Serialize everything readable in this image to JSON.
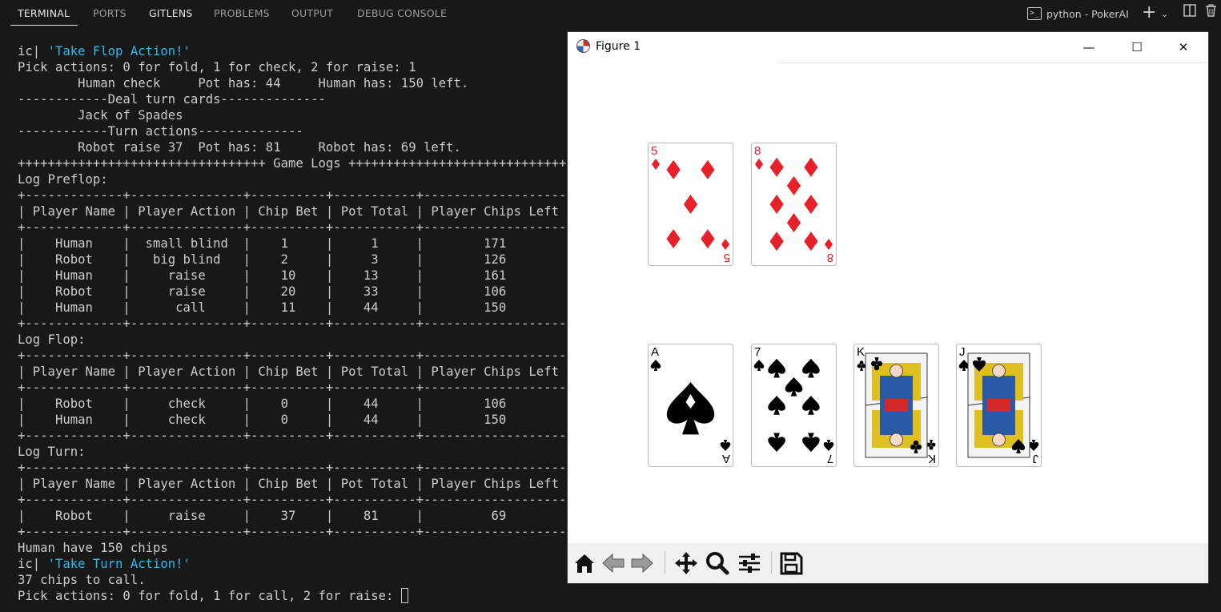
{
  "panel": {
    "tabs": [
      {
        "label": "TERMINAL",
        "active": true
      },
      {
        "label": "PORTS",
        "active": false
      },
      {
        "label": "GITLENS",
        "active": false
      },
      {
        "label": "PROBLEMS",
        "active": false
      },
      {
        "label": "OUTPUT",
        "active": false
      },
      {
        "label": "DEBUG CONSOLE",
        "active": false
      }
    ],
    "terminal_name": "python - PokerAI",
    "icons": [
      "terminal-icon",
      "plus-icon",
      "chevron-down-icon",
      "split-icon",
      "trash-icon"
    ]
  },
  "terminal": {
    "lines": [
      {
        "prefix": "ic| ",
        "string": "'Take Flop Action!'"
      },
      {
        "text": "Pick actions: 0 for fold, 1 for check, 2 for raise: 1"
      },
      {
        "text": "        Human check     Pot has: 44     Human has: 150 left."
      },
      {
        "text": "------------Deal turn cards--------------"
      },
      {
        "text": "        Jack of Spades"
      },
      {
        "text": "------------Turn actions--------------"
      },
      {
        "text": "        Robot raise 37  Pot has: 81     Robot has: 69 left."
      },
      {
        "text": "+++++++++++++++++++++++++++++++++ Game Logs +++++++++++++++++++++++++++++++++"
      },
      {
        "text": "Log Preflop:"
      },
      {
        "text": "+-------------+---------------+----------+-----------+-------------------+"
      },
      {
        "text": "| Player Name | Player Action | Chip Bet | Pot Total | Player Chips Left |"
      },
      {
        "text": "+-------------+---------------+----------+-----------+-------------------+"
      },
      {
        "text": "|    Human    |  small blind  |    1     |     1     |        171        |"
      },
      {
        "text": "|    Robot    |   big blind   |    2     |     3     |        126        |"
      },
      {
        "text": "|    Human    |     raise     |    10    |    13     |        161        |"
      },
      {
        "text": "|    Robot    |     raise     |    20    |    33     |        106        |"
      },
      {
        "text": "|    Human    |      call     |    11    |    44     |        150        |"
      },
      {
        "text": "+-------------+---------------+----------+-----------+-------------------+"
      },
      {
        "text": "Log Flop:"
      },
      {
        "text": "+-------------+---------------+----------+-----------+-------------------+"
      },
      {
        "text": "| Player Name | Player Action | Chip Bet | Pot Total | Player Chips Left |"
      },
      {
        "text": "+-------------+---------------+----------+-----------+-------------------+"
      },
      {
        "text": "|    Robot    |     check     |    0     |    44     |        106        |"
      },
      {
        "text": "|    Human    |     check     |    0     |    44     |        150        |"
      },
      {
        "text": "+-------------+---------------+----------+-----------+-------------------+"
      },
      {
        "text": "Log Turn:"
      },
      {
        "text": "+-------------+---------------+----------+-----------+-------------------+"
      },
      {
        "text": "| Player Name | Player Action | Chip Bet | Pot Total | Player Chips Left |"
      },
      {
        "text": "+-------------+---------------+----------+-----------+-------------------+"
      },
      {
        "text": "|    Robot    |     raise     |    37    |    81     |         69        |"
      },
      {
        "text": "+-------------+---------------+----------+-----------+-------------------+"
      },
      {
        "text": "Human have 150 chips"
      },
      {
        "prefix": "ic| ",
        "string": "'Take Turn Action!'"
      },
      {
        "text": "37 chips to call."
      },
      {
        "text": "Pick actions: 0 for fold, 1 for call, 2 for raise: ",
        "cursor": true
      }
    ]
  },
  "figure": {
    "title": "Figure 1",
    "window_buttons": {
      "minimize": "—",
      "maximize": "☐",
      "close": "✕"
    },
    "hand_cards": [
      {
        "rank": "5",
        "suit": "diamonds",
        "color": "#e8202a"
      },
      {
        "rank": "8",
        "suit": "diamonds",
        "color": "#e8202a"
      }
    ],
    "board_cards": [
      {
        "rank": "A",
        "suit": "spades",
        "color": "#000000"
      },
      {
        "rank": "7",
        "suit": "spades",
        "color": "#000000"
      },
      {
        "rank": "K",
        "suit": "clubs",
        "color": "#000000"
      },
      {
        "rank": "J",
        "suit": "spades",
        "color": "#000000"
      }
    ],
    "toolbar": [
      "home-icon",
      "back-icon",
      "forward-icon",
      "pan-icon",
      "zoom-icon",
      "configure-subplots-icon",
      "save-icon"
    ]
  },
  "colors": {
    "background": "#181818",
    "text": "#cccccc",
    "string": "#2fb8e8",
    "red_suit": "#e8202a"
  }
}
